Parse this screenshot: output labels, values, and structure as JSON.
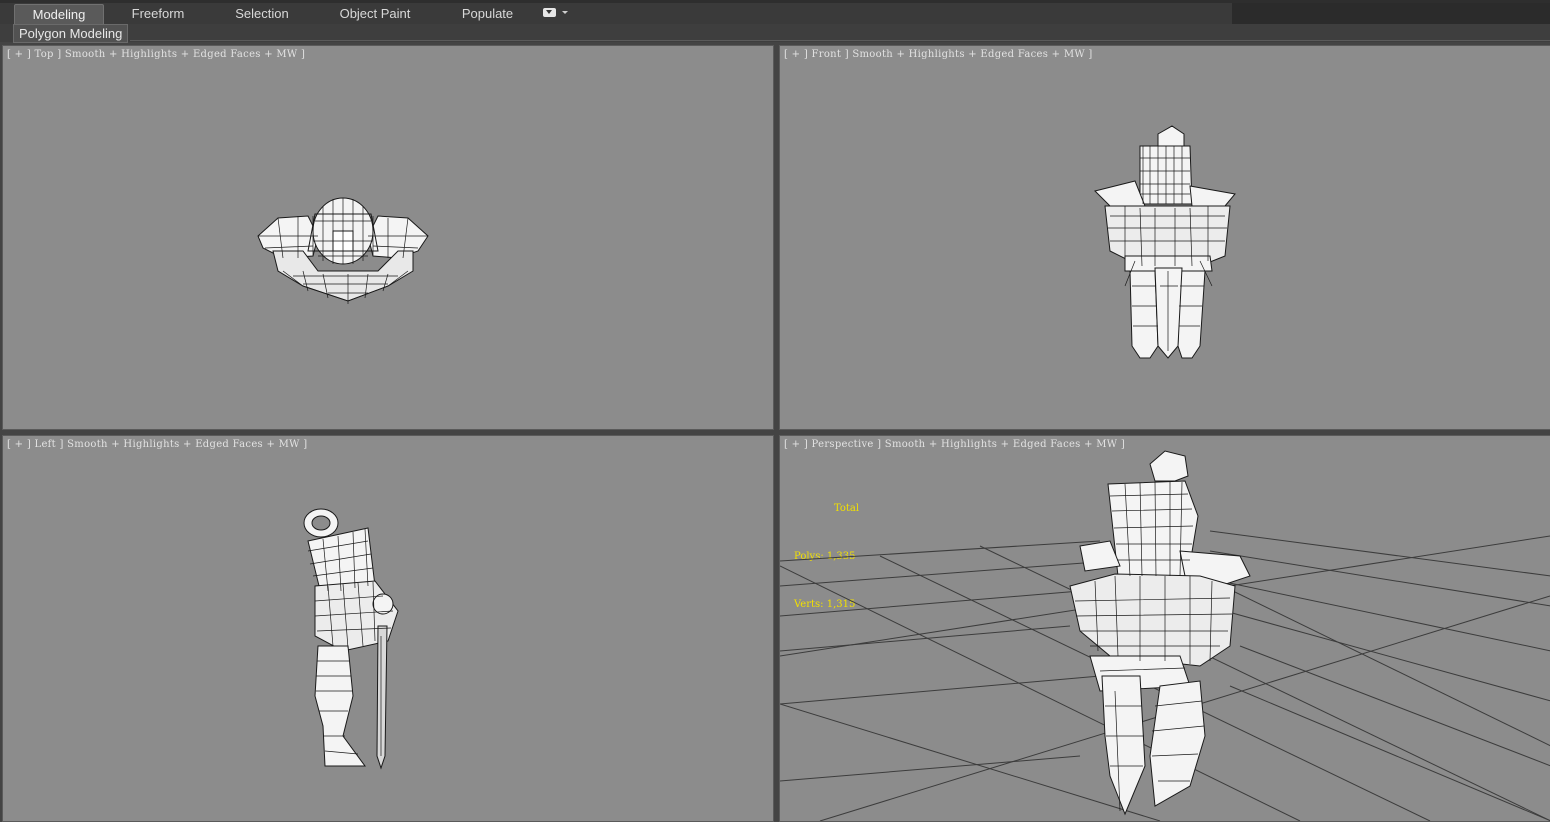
{
  "ribbon": {
    "tabs": [
      {
        "label": "Modeling",
        "active": true
      },
      {
        "label": "Freeform",
        "active": false
      },
      {
        "label": "Selection",
        "active": false
      },
      {
        "label": "Object Paint",
        "active": false
      },
      {
        "label": "Populate",
        "active": false
      }
    ],
    "menu_icon": "dropdown-menu-icon"
  },
  "subbar": {
    "label": "Polygon Modeling"
  },
  "viewports": {
    "top": {
      "label": "[ + ] Top ] Smooth + Highlights + Edged Faces + MW ]"
    },
    "front": {
      "label": "[ + ] Front ] Smooth + Highlights + Edged Faces + MW ]"
    },
    "left": {
      "label": "[ + ] Left ] Smooth + Highlights + Edged Faces + MW ]"
    },
    "perspective": {
      "label": "[ + ] Perspective ] Smooth + Highlights + Edged Faces + MW ]",
      "stats": {
        "total_label": "Total",
        "polys_label": "Polys:",
        "polys_value": "1,335",
        "verts_label": "Verts:",
        "verts_value": "1,315"
      }
    }
  },
  "colors": {
    "viewport_bg": "#8c8c8c",
    "stats_text": "#f2e000",
    "mesh_fill": "#f4f4f4",
    "mesh_edge": "#1a1a1a",
    "grid_line": "#3c3c3c"
  }
}
